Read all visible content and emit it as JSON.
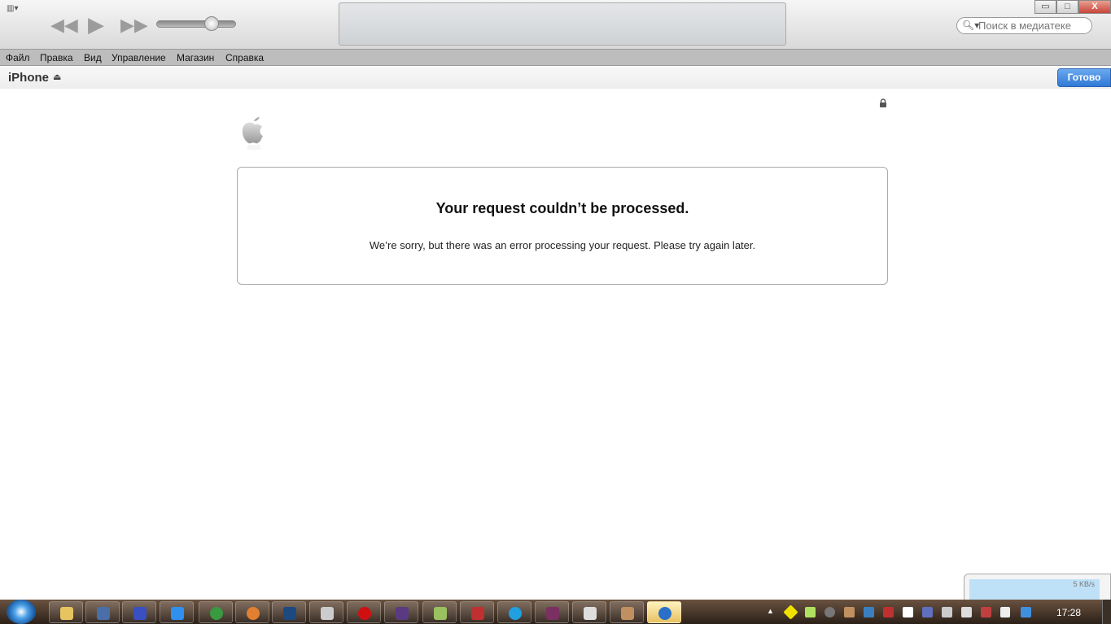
{
  "toolbar": {
    "search_placeholder": "Поиск в медиатеке",
    "icons": [
      "sidebar-toggle-icon",
      "rewind-icon",
      "play-icon",
      "fast-forward-icon",
      "volume-slider",
      "apple-icon"
    ],
    "volume_percent": 65
  },
  "window_controls": {
    "minimize": "▭",
    "maximize": "□",
    "close": "X"
  },
  "menu": [
    "Файл",
    "Правка",
    "Вид",
    "Управление",
    "Магазин",
    "Справка"
  ],
  "device": {
    "name": "iPhone",
    "done_label": "Готово"
  },
  "error": {
    "title": "Your request couldn’t be processed.",
    "message": "We’re sorry, but there was an error processing your request. Please try again later."
  },
  "notification": {
    "speed": "5 KB/s"
  },
  "taskbar": {
    "clock": "17:28",
    "apps": [
      "explorer",
      "kmplayer",
      "save",
      "blank",
      "chrome",
      "picasa",
      "photoshop",
      "font",
      "opera",
      "premiere",
      "messages",
      "kaspersky",
      "skype",
      "winrar",
      "app",
      "app2",
      "itunes"
    ],
    "accent": "#2f79d6"
  }
}
